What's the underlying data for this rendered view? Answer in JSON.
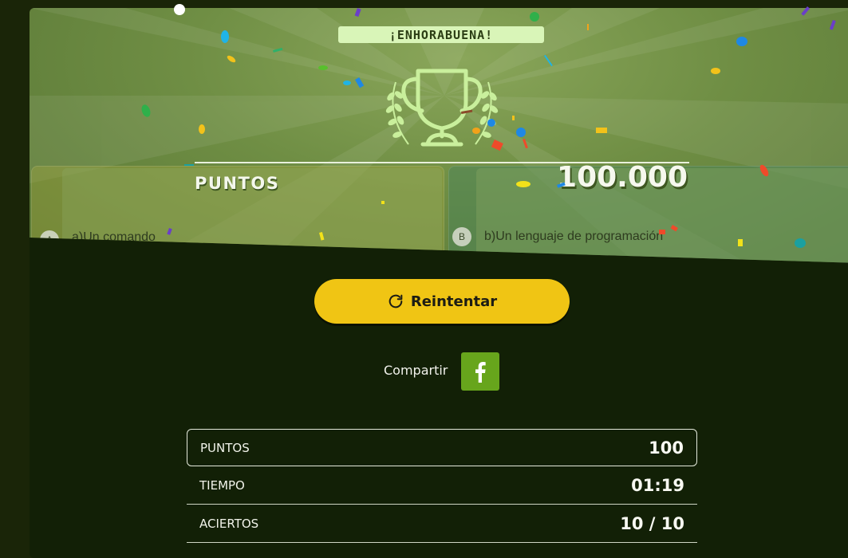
{
  "hero": {
    "congrats": "¡ENHORABUENA!",
    "score_label": "PUNTOS",
    "score_value": "100.000",
    "bg_options": [
      {
        "letter": "A",
        "text": "a)Un comando"
      },
      {
        "letter": "B",
        "text": "b)Un lenguaje de programación"
      }
    ]
  },
  "actions": {
    "retry_label": "Reintentar",
    "share_label": "Compartir",
    "share_icon": "facebook-icon"
  },
  "stats": [
    {
      "label": "PUNTOS",
      "value": "100"
    },
    {
      "label": "TIEMPO",
      "value": "01:19"
    },
    {
      "label": "ACIERTOS",
      "value": "10 / 10"
    }
  ],
  "colors": {
    "accent_yellow": "#f0c514",
    "facebook_green": "#67a51c",
    "background": "#122006",
    "hero_green": "#6f8e44"
  }
}
